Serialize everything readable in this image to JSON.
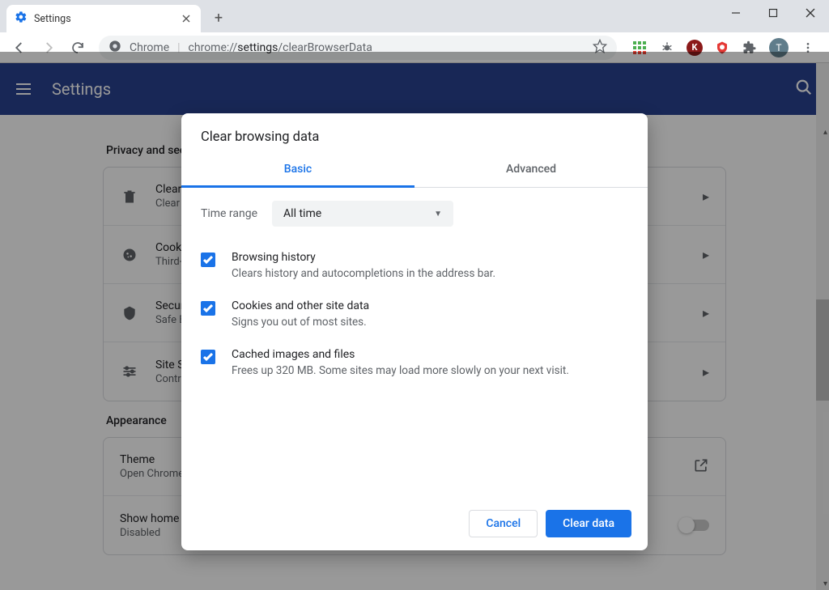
{
  "browserTab": {
    "title": "Settings"
  },
  "omnibox": {
    "scheme_label": "Chrome",
    "url_host": "chrome://",
    "url_path_strong": "settings",
    "url_path_rest": "/clearBrowserData"
  },
  "settings": {
    "pageTitle": "Settings",
    "sections": {
      "privacy": {
        "heading": "Privacy and security",
        "rows": [
          {
            "title": "Clear browsing data",
            "sub": "Clear history, cookies, cache, and more"
          },
          {
            "title": "Cookies and other site data",
            "sub": "Third-party cookies are blocked in Incognito mode"
          },
          {
            "title": "Security",
            "sub": "Safe Browsing (protection from dangerous sites) and other security settings"
          },
          {
            "title": "Site Settings",
            "sub": "Controls what information sites can use and show"
          }
        ]
      },
      "appearance": {
        "heading": "Appearance",
        "rows": [
          {
            "title": "Theme",
            "sub": "Open Chrome Web Store"
          },
          {
            "title": "Show home button",
            "sub": "Disabled"
          }
        ]
      }
    }
  },
  "dialog": {
    "title": "Clear browsing data",
    "tabs": {
      "basic": "Basic",
      "advanced": "Advanced"
    },
    "timeRange": {
      "label": "Time range",
      "value": "All time"
    },
    "items": [
      {
        "title": "Browsing history",
        "sub": "Clears history and autocompletions in the address bar."
      },
      {
        "title": "Cookies and other site data",
        "sub": "Signs you out of most sites."
      },
      {
        "title": "Cached images and files",
        "sub": "Frees up 320 MB. Some sites may load more slowly on your next visit."
      }
    ],
    "actions": {
      "cancel": "Cancel",
      "confirm": "Clear data"
    }
  }
}
